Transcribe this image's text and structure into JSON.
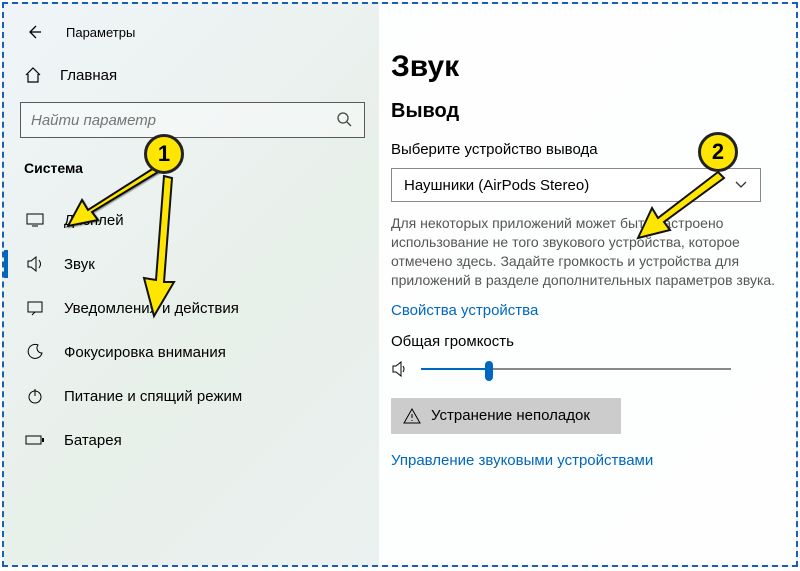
{
  "window": {
    "title": "Параметры"
  },
  "home": {
    "label": "Главная"
  },
  "search": {
    "placeholder": "Найти параметр"
  },
  "category": {
    "label": "Система"
  },
  "nav": [
    {
      "icon": "display",
      "label": "Дисплей",
      "active": false
    },
    {
      "icon": "sound",
      "label": "Звук",
      "active": true
    },
    {
      "icon": "notify",
      "label": "Уведомления и действия",
      "active": false
    },
    {
      "icon": "focus",
      "label": "Фокусировка внимания",
      "active": false
    },
    {
      "icon": "power",
      "label": "Питание и спящий режим",
      "active": false
    },
    {
      "icon": "battery",
      "label": "Батарея",
      "active": false
    }
  ],
  "content": {
    "page_title": "Звук",
    "output_header": "Вывод",
    "output_label": "Выберите устройство вывода",
    "output_value": "Наушники (AirPods Stereo)",
    "help_text": "Для некоторых приложений может быть настроено использование не того звукового устройства, которое отмечено здесь. Задайте громкость и устройства для приложений в разделе дополнительных параметров звука.",
    "device_properties": "Свойства устройства",
    "volume_label": "Общая громкость",
    "volume_value": 22,
    "troubleshoot": "Устранение неполадок",
    "manage_link": "Управление звуковыми устройствами"
  },
  "callouts": {
    "c1": "1",
    "c2": "2"
  }
}
